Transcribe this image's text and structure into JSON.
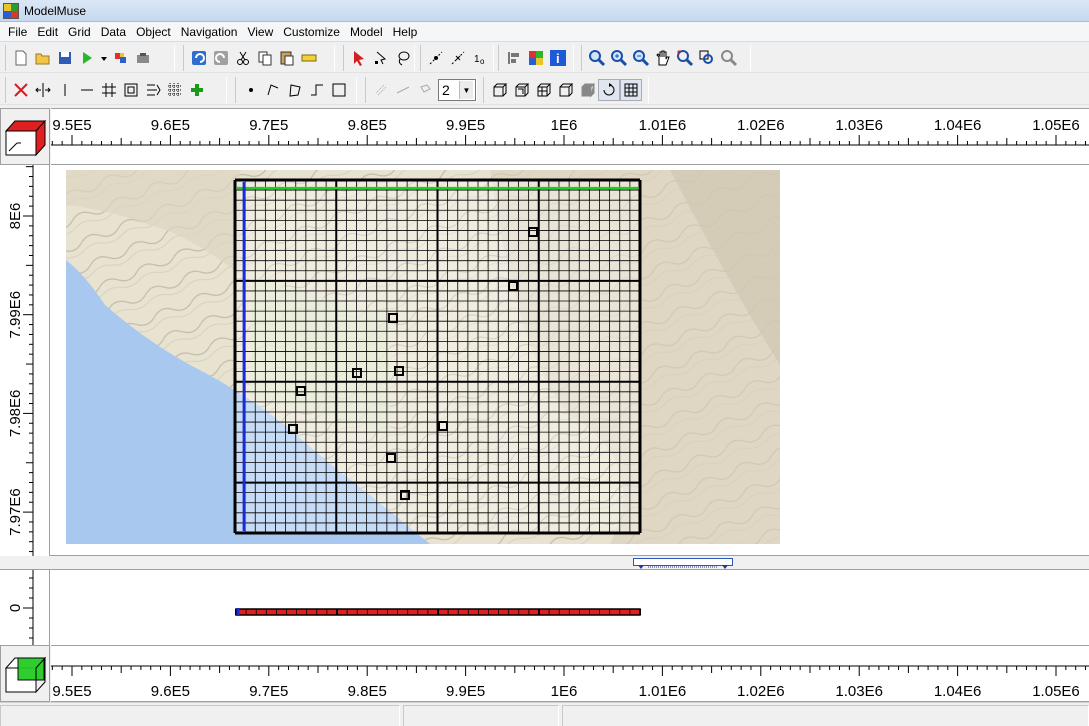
{
  "window": {
    "title": "ModelMuse"
  },
  "menu": [
    "File",
    "Edit",
    "Grid",
    "Data",
    "Object",
    "Navigation",
    "View",
    "Customize",
    "Model",
    "Help"
  ],
  "toolbar1": {
    "file_group": [
      "new-file-icon",
      "open-folder-icon",
      "save-icon",
      "run-model-icon",
      "dropdown-arrow-icon",
      "export-icon",
      "import-icon"
    ],
    "edit_group": [
      "undo-icon",
      "redo-icon",
      "cut-icon",
      "copy-icon",
      "paste-icon",
      "ruler-icon"
    ],
    "select_group": [
      "select-arrow-icon",
      "select-vertex-icon",
      "lasso-icon"
    ],
    "vertex_group": [
      "add-vertex-icon",
      "delete-vertex-icon",
      "vertex-value-icon"
    ],
    "info_group": [
      "object-order-icon",
      "color-grid-icon",
      "info-icon"
    ],
    "zoom_group": [
      "zoom-icon",
      "zoom-in-icon",
      "zoom-out-icon",
      "pan-icon",
      "zoom-extents-icon",
      "zoom-layer-icon",
      "zoom-previous-icon"
    ]
  },
  "toolbar2": {
    "grid_group": [
      "delete-gridline-icon",
      "move-gridline-icon",
      "add-vertical-gridline-icon",
      "add-horizontal-gridline-icon",
      "add-gridlines-icon",
      "generate-grid-icon",
      "smooth-grid-icon",
      "subdivide-icon",
      "add-point-icon"
    ],
    "draw_group": [
      "point-object-icon",
      "line-object-icon",
      "polygon-object-icon",
      "straight-line-icon",
      "rectangle-icon"
    ],
    "layer_group": [
      "layer-icon-1",
      "layer-icon-2",
      "layer-icon-3"
    ],
    "layer_combo_value": "2",
    "view3d_group": [
      "view-3d-icon-1",
      "view-3d-icon-2",
      "view-3d-icon-3",
      "view-3d-icon-4",
      "shaded-3d-icon",
      "rotate-3d-icon",
      "grid-3d-icon"
    ]
  },
  "top_view": {
    "x_ticks": [
      "9.5E5",
      "9.6E5",
      "9.7E5",
      "9.8E5",
      "9.9E5",
      "1E6",
      "1.01E6",
      "1.02E6",
      "1.03E6",
      "1.04E6",
      "1.05E6"
    ],
    "y_ticks": [
      "8E6",
      "7.99E6",
      "7.98E6",
      "7.97E6"
    ],
    "grid": {
      "columns": 40,
      "rows": 35,
      "major_every": 10
    },
    "observation_points": 10
  },
  "front_view": {
    "y_ticks": [
      "0"
    ]
  },
  "bottom_ruler": {
    "x_ticks": [
      "9.5E5",
      "9.6E5",
      "9.7E5",
      "9.8E5",
      "9.9E5",
      "1E6",
      "1.01E6",
      "1.02E6",
      "1.03E6",
      "1.04E6",
      "1.05E6"
    ]
  },
  "colors": {
    "grid_line": "#000000",
    "top_row_highlight": "#22cc22",
    "first_column_highlight": "#1a2bd8",
    "front_layer": "#e02020",
    "ocean": "#a8c8f0",
    "terrain": "#e8e2d0"
  }
}
